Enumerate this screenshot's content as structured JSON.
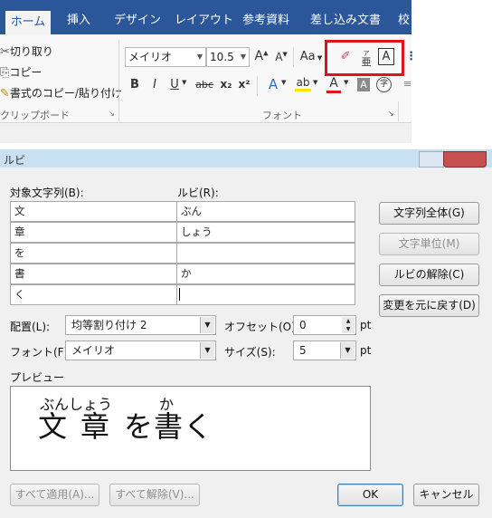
{
  "ribbon": {
    "tabs": [
      "ホーム",
      "挿入",
      "デザイン",
      "レイアウト",
      "参考資料",
      "差し込み文書",
      "校"
    ],
    "clipboard": {
      "cut": "切り取り",
      "copy": "コピー",
      "format_painter": "書式のコピー/貼り付け",
      "group_label": "クリップボード"
    },
    "font": {
      "name": "メイリオ",
      "size": "10.5",
      "grow": "A",
      "shrink": "A",
      "change_case": "Aa",
      "phonetic_guide": "亜",
      "char_border": "A",
      "bold": "B",
      "italic": "I",
      "underline": "U",
      "strike": "abc",
      "subscript": "x₂",
      "superscript": "x²",
      "text_effects": "A",
      "highlight": "ab",
      "font_color": "A",
      "char_shading": "A",
      "enclose": "字",
      "group_label": "フォント"
    },
    "highlight_color": "#e0131b",
    "accent": "#2b579a"
  },
  "dialog": {
    "title": "ルビ",
    "base_text_label": "対象文字列(B):",
    "ruby_label": "ルビ(R):",
    "rows": [
      {
        "base": "文",
        "ruby": "ぶん"
      },
      {
        "base": "章",
        "ruby": "しょう"
      },
      {
        "base": "を",
        "ruby": ""
      },
      {
        "base": "書",
        "ruby": "か"
      },
      {
        "base": "く",
        "ruby": ""
      }
    ],
    "buttons": {
      "group_all": "文字列全体(G)",
      "mono": "文字単位(M)",
      "remove": "ルビの解除(C)",
      "default": "変更を元に戻す(D)",
      "apply_all": "すべて適用(A)...",
      "remove_all": "すべて解除(V)...",
      "ok": "OK",
      "cancel": "キャンセル"
    },
    "alignment_label": "配置(L):",
    "alignment_value": "均等割り付け 2",
    "offset_label": "オフセット(O):",
    "offset_value": "0",
    "offset_unit": "pt",
    "font_label": "フォント(F):",
    "font_value": "メイリオ",
    "size_label": "サイズ(S):",
    "size_value": "5",
    "size_unit": "pt",
    "preview_label": "プレビュー",
    "preview": {
      "ruby1": "ぶんしょう",
      "ruby2": "か",
      "base1": "文",
      "base2": "章",
      "base3": "を",
      "base4": "書",
      "base5": "く"
    }
  }
}
